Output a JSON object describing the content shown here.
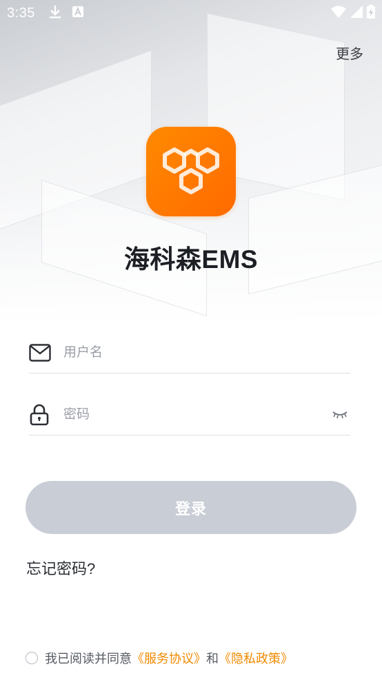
{
  "status_bar": {
    "time": "3:35"
  },
  "header": {
    "more_label": "更多"
  },
  "app": {
    "title": "海科森EMS"
  },
  "form": {
    "username_placeholder": "用户名",
    "password_placeholder": "密码",
    "login_label": "登录",
    "forgot_label": "忘记密码?"
  },
  "agreement": {
    "prefix": "我已阅读并同意",
    "service_link": "《服务协议》",
    "conjunction": "和",
    "privacy_link": "《隐私政策》"
  },
  "colors": {
    "brand_orange": "#ff7a00",
    "link_orange": "#f08a00",
    "button_disabled": "#c8cdd6"
  },
  "icons": {
    "username": "mail-icon",
    "password": "lock-icon",
    "visibility": "eye-closed-icon",
    "logo": "hexagon-logo-icon"
  }
}
